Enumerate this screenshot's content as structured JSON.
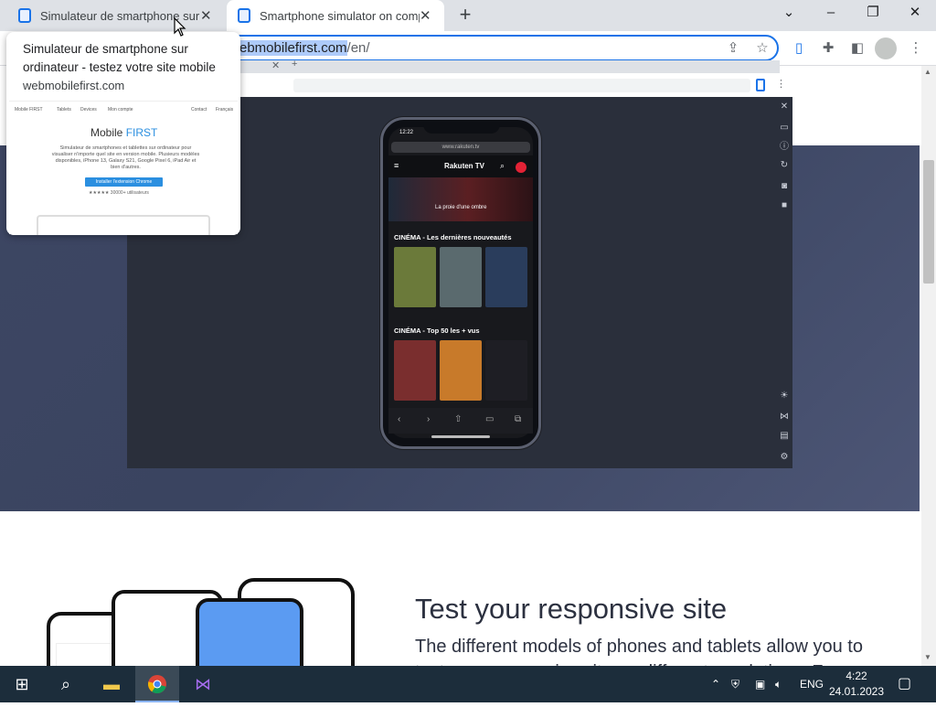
{
  "tabs": [
    {
      "title": "Simulateur de smartphone sur ordinateur - testez votre site mobile",
      "display": "Simulateur de smartphone sur or"
    },
    {
      "title": "Smartphone simulator on computer",
      "display": "Smartphone simulator on compu"
    }
  ],
  "address": {
    "selected": "webmobilefirst.com",
    "visible_selected": "ebmobilefirst.com",
    "path": "/en/"
  },
  "hovercard": {
    "title": "Simulateur de smartphone sur ordinateur - testez votre site mobile",
    "domain": "webmobilefirst.com",
    "preview": {
      "nav": [
        "Mobile FIRST",
        "Tablets",
        "Devices",
        "Mon compte",
        "Contact",
        "Français"
      ],
      "title_a": "Mobile",
      "title_b": "FIRST",
      "desc": "Simulateur de smartphones et tablettes sur ordinateur pour visualiser n'importe quel site en version mobile. Plusieurs modèles disponibles, iPhone 13, Galaxy S21, Google Pixel 6, iPad Air et bien d'autres.",
      "button": "Installer l'extension Chrome",
      "rating": "★★★★★ 30000+ utilisateurs"
    }
  },
  "phone": {
    "time": "12:22",
    "url": "www.rakuten.tv",
    "logo": "Rakuten TV",
    "banner_title": "La proie d'une ombre",
    "section1": "CINÉMA - Les dernières nouveautés",
    "section2": "CINÉMA - Top 50 les + vus",
    "posters1": [
      "#6b7a3a",
      "#5a6a6e",
      "#2a3d5c"
    ],
    "posters2": [
      "#7a2e2e",
      "#c87a2a",
      "#1e1e24"
    ],
    "nav": [
      "‹",
      "›",
      "⇧",
      "▭",
      "⧉"
    ]
  },
  "content": {
    "heading": "Test your responsive site",
    "sub": "The different models of phones and tablets allow you to test your responsive site on different resolutions. From"
  },
  "tray": {
    "lang": "ENG",
    "time": "4:22",
    "date": "24.01.2023"
  },
  "colors": {
    "accent": "#1a73e8",
    "hero": "#3d4663",
    "taskbar": "#1c2d3b"
  }
}
